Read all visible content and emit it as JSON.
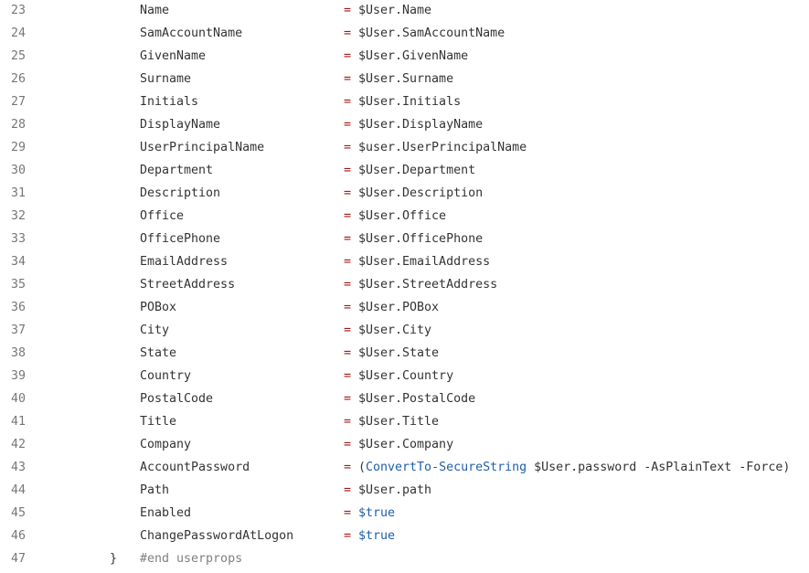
{
  "lines": [
    {
      "num": "23",
      "prop": "Name",
      "value": "$User.Name"
    },
    {
      "num": "24",
      "prop": "SamAccountName",
      "value": "$User.SamAccountName"
    },
    {
      "num": "25",
      "prop": "GivenName",
      "value": "$User.GivenName"
    },
    {
      "num": "26",
      "prop": "Surname",
      "value": "$User.Surname"
    },
    {
      "num": "27",
      "prop": "Initials",
      "value": "$User.Initials"
    },
    {
      "num": "28",
      "prop": "DisplayName",
      "value": "$User.DisplayName"
    },
    {
      "num": "29",
      "prop": "UserPrincipalName",
      "value": "$user.UserPrincipalName"
    },
    {
      "num": "30",
      "prop": "Department",
      "value": "$User.Department"
    },
    {
      "num": "31",
      "prop": "Description",
      "value": "$User.Description"
    },
    {
      "num": "32",
      "prop": "Office",
      "value": "$User.Office"
    },
    {
      "num": "33",
      "prop": "OfficePhone",
      "value": "$User.OfficePhone"
    },
    {
      "num": "34",
      "prop": "EmailAddress",
      "value": "$User.EmailAddress"
    },
    {
      "num": "35",
      "prop": "StreetAddress",
      "value": "$User.StreetAddress"
    },
    {
      "num": "36",
      "prop": "POBox",
      "value": "$User.POBox"
    },
    {
      "num": "37",
      "prop": "City",
      "value": "$User.City"
    },
    {
      "num": "38",
      "prop": "State",
      "value": "$User.State"
    },
    {
      "num": "39",
      "prop": "Country",
      "value": "$User.Country"
    },
    {
      "num": "40",
      "prop": "PostalCode",
      "value": "$User.PostalCode"
    },
    {
      "num": "41",
      "prop": "Title",
      "value": "$User.Title"
    },
    {
      "num": "42",
      "prop": "Company",
      "value": "$User.Company"
    },
    {
      "num": "43",
      "prop": "AccountPassword",
      "value_parts": [
        {
          "text": "(",
          "cls": ""
        },
        {
          "text": "ConvertTo-SecureString",
          "cls": "kw"
        },
        {
          "text": " $User.password -AsPlainText -Force)",
          "cls": ""
        }
      ]
    },
    {
      "num": "44",
      "prop": "Path",
      "value": "$User.path"
    },
    {
      "num": "45",
      "prop": "Enabled",
      "value_kw": "$true"
    },
    {
      "num": "46",
      "prop": "ChangePasswordAtLogon",
      "value_kw": "$true"
    }
  ],
  "equals": "=",
  "last_line": {
    "num": "47",
    "brace": "}",
    "comment": "#end userprops"
  },
  "colors": {
    "operator": "#a31515",
    "keyword": "#1f5fa8",
    "comment": "#808080",
    "line_number": "#777777"
  }
}
